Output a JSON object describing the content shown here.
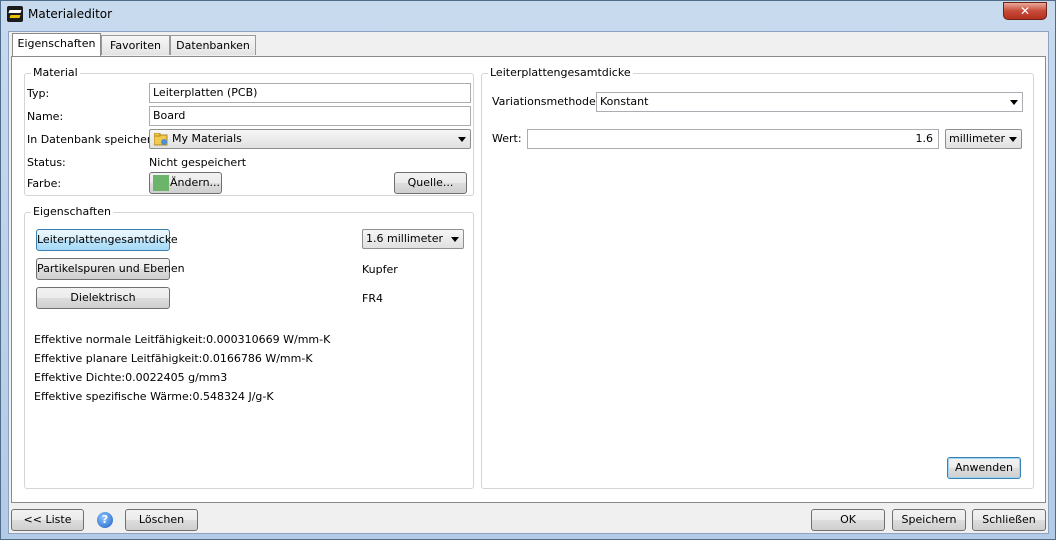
{
  "window": {
    "title": "Materialeditor",
    "close_symbol": "✕"
  },
  "tabs": [
    {
      "label": "Eigenschaften",
      "active": true
    },
    {
      "label": "Favoriten",
      "active": false
    },
    {
      "label": "Datenbanken",
      "active": false
    }
  ],
  "material": {
    "group_title": "Material",
    "type_label": "Typ:",
    "type_value": "Leiterplatten (PCB)",
    "name_label": "Name:",
    "name_value": "Board",
    "db_label": "In Datenbank speichern:",
    "db_value": "My Materials",
    "status_label": "Status:",
    "status_value": "Nicht gespeichert",
    "color_label": "Farbe:",
    "color_button": "Ändern...",
    "color_value": "#6db46b",
    "source_button": "Quelle..."
  },
  "properties": {
    "group_title": "Eigenschaften",
    "rows": [
      {
        "button": "Leiterplattengesamtdicke",
        "value": "1.6 millimeter",
        "selected": true
      },
      {
        "button": "Partikelspuren und Ebenen",
        "value": "Kupfer",
        "selected": false
      },
      {
        "button": "Dielektrisch",
        "value": "FR4",
        "selected": false
      }
    ],
    "effective": [
      "Effektive normale Leitfähigkeit:0.000310669 W/mm-K",
      "Effektive planare Leitfähigkeit:0.0166786 W/mm-K",
      "Effektive Dichte:0.0022405 g/mm3",
      "Effektive spezifische Wärme:0.548324 J/g-K"
    ]
  },
  "detail": {
    "group_title": "Leiterplattengesamtdicke",
    "method_label": "Variationsmethode:",
    "method_value": "Konstant",
    "value_label": "Wert:",
    "value": "1.6",
    "unit": "millimeter",
    "apply_button": "Anwenden"
  },
  "footer": {
    "list_button": "<< Liste",
    "help_symbol": "?",
    "delete_button": "Löschen",
    "ok_button": "OK",
    "save_button": "Speichern",
    "close_button": "Schließen"
  }
}
